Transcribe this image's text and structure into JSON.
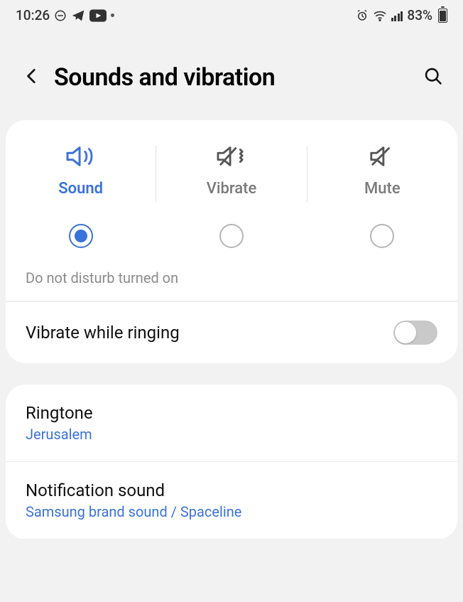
{
  "statusBar": {
    "time": "10:26",
    "batteryPercent": "83%"
  },
  "header": {
    "title": "Sounds and vibration"
  },
  "modes": {
    "sound": {
      "label": "Sound",
      "active": true
    },
    "vibrate": {
      "label": "Vibrate",
      "active": false
    },
    "mute": {
      "label": "Mute",
      "active": false
    }
  },
  "dndNote": "Do not disturb turned on",
  "vibrateWhileRinging": {
    "label": "Vibrate while ringing",
    "value": false
  },
  "ringtone": {
    "label": "Ringtone",
    "value": "Jerusalem"
  },
  "notificationSound": {
    "label": "Notification sound",
    "value": "Samsung brand sound / Spaceline"
  }
}
